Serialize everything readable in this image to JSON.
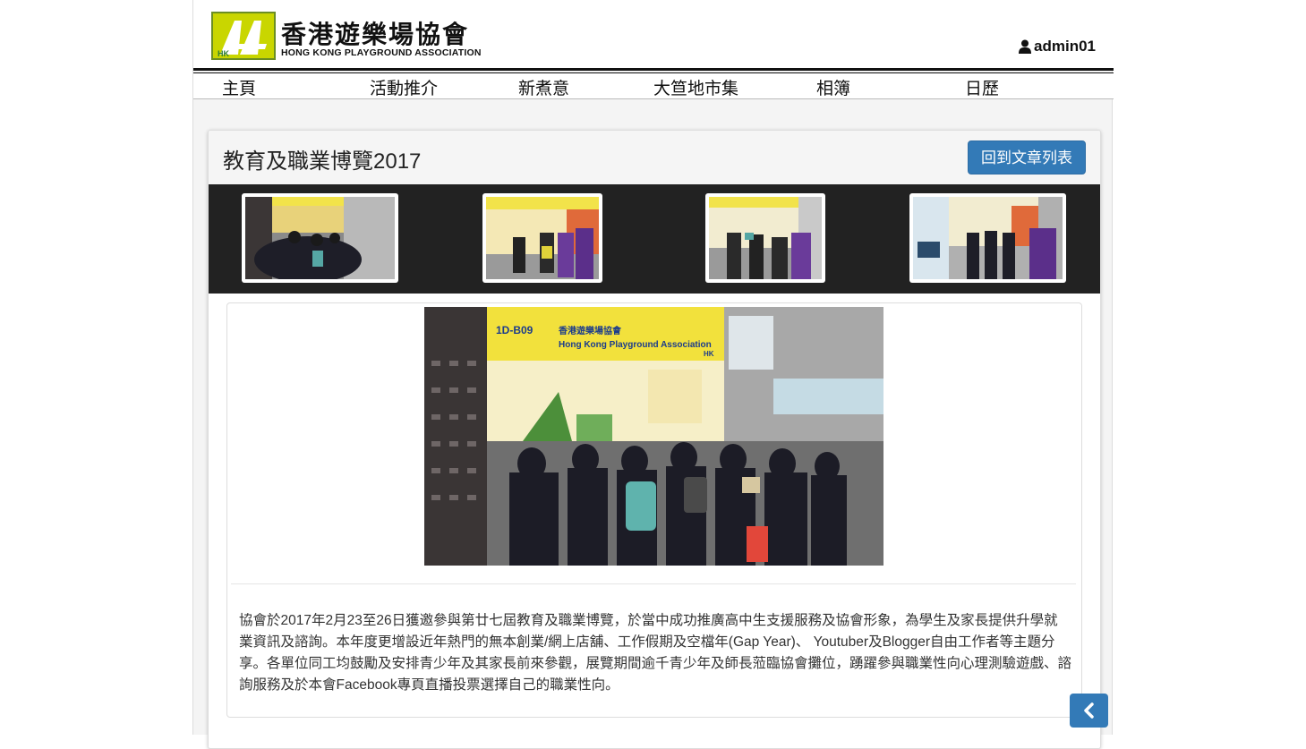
{
  "header": {
    "logo_cn": "香港遊樂場協會",
    "logo_en": "HONG KONG PLAYGROUND ASSOCIATION",
    "logo_letters": "HK",
    "user_name": "admin01"
  },
  "nav": [
    {
      "label": "主頁"
    },
    {
      "label": "活動推介"
    },
    {
      "label": "新煮意"
    },
    {
      "label": "大笪地市集"
    },
    {
      "label": "相簿"
    },
    {
      "label": "日歷"
    }
  ],
  "article": {
    "title": "教育及職業博覽2017",
    "back_label": "回到文章列表",
    "body": "協會於2017年2月23至26日獲邀參與第廿七屆教育及職業博覽，於當中成功推廣高中生支援服務及協會形象，為學生及家長提供升學就業資訊及諮詢。本年度更增設近年熱門的無本創業/網上店舖、工作假期及空檔年(Gap Year)、 Youtuber及Blogger自由工作者等主題分享。各單位同工均鼓勵及安排青少年及其家長前來參觀，展覽期間逾千青少年及師長蒞臨協會攤位，踴躍參與職業性向心理測驗遊戲、諮詢服務及於本會Facebook專頁直播投票選擇自己的職業性向。"
  },
  "photo": {
    "booth_code": "1D-B09",
    "booth_cn": "香港遊樂場協會",
    "booth_en": "Hong Kong Playground Association",
    "booth_tag": "HK"
  },
  "icons": {
    "user": "user-icon",
    "back": "chevron-left-icon"
  },
  "colors": {
    "primary": "#337ab7",
    "logo_green": "#c8d400",
    "strip_bg": "#222222"
  }
}
